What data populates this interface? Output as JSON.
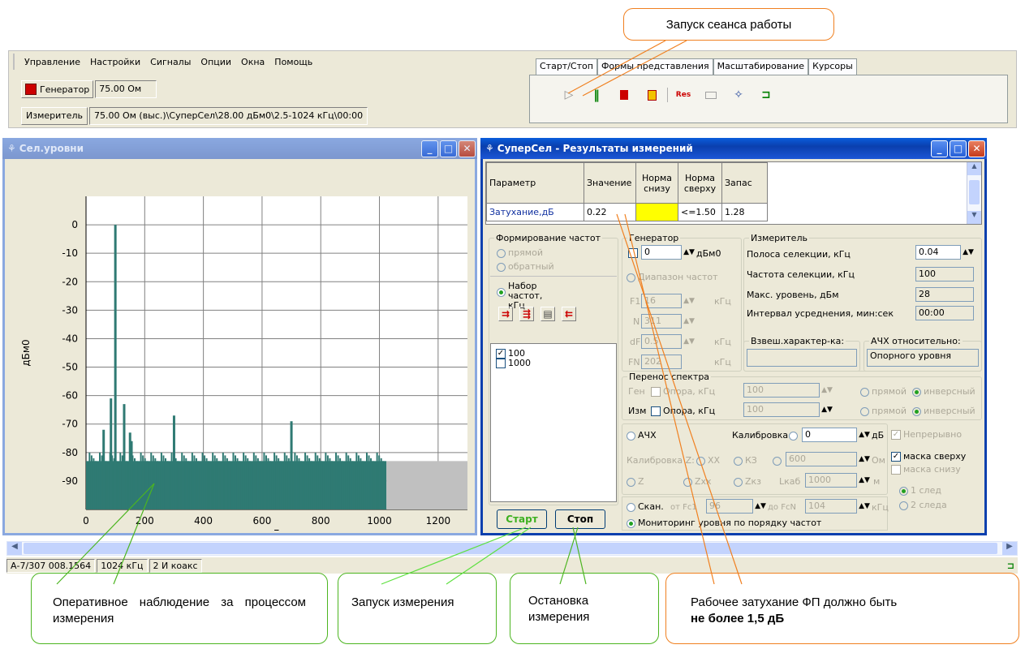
{
  "menu": [
    "Управление",
    "Настройки",
    "Сигналы",
    "Опции",
    "Окна",
    "Помощь"
  ],
  "generator": {
    "label": "Генератор",
    "value": "75.00 Ом"
  },
  "meter": {
    "label": "Измеритель",
    "value": "75.00 Ом (выс.)\\СуперСел\\28.00 дБм0\\2.5-1024 кГц\\00:00"
  },
  "tabs": [
    "Старт/Стоп",
    "Формы представления",
    "Масштабирование",
    "Курсоры"
  ],
  "toolbar": {
    "res_label": "Res",
    "colors": {
      "play": "#808080",
      "pause": "#008000",
      "stop": "#cc0000",
      "res": "#cc0000"
    }
  },
  "spectrum_window": {
    "title": "Сел.уровни",
    "ylabel": "дБм0",
    "xlabel": "кГц"
  },
  "chart_data": {
    "type": "area",
    "xlim": [
      0,
      1300
    ],
    "ylim": [
      -100,
      10
    ],
    "yticks": [
      0,
      -10,
      -20,
      -30,
      -40,
      -50,
      -60,
      -70,
      -80,
      -90
    ],
    "xticks": [
      0,
      200,
      400,
      600,
      800,
      1000,
      1200
    ],
    "ytick_labels": [
      "0",
      "-10",
      "-20",
      "-30",
      "-40",
      "-50",
      "-60",
      "-70",
      "-80",
      "-90"
    ],
    "xtick_labels": [
      "0",
      "200",
      "400",
      "600",
      "800",
      "1000",
      "1200"
    ],
    "xlabel": "кГц",
    "ylabel": "дБм0",
    "noise_floor": -83,
    "active_range_khz": [
      0,
      1024
    ],
    "peaks": [
      {
        "x": 100,
        "y": 0
      },
      {
        "x": 85,
        "y": -61
      },
      {
        "x": 130,
        "y": -63
      },
      {
        "x": 300,
        "y": -67
      },
      {
        "x": 700,
        "y": -69
      },
      {
        "x": 60,
        "y": -72
      },
      {
        "x": 150,
        "y": -73
      },
      {
        "x": 155,
        "y": -76
      }
    ],
    "colors": {
      "series": "#2f7a73",
      "inactive": "#c0c0c0"
    }
  },
  "results_window": {
    "title": "СуперСел - Результаты измерений"
  },
  "results_table": {
    "headers": [
      "Параметр",
      "Значение",
      "Норма снизу",
      "Норма сверху",
      "Запас"
    ],
    "row": {
      "param": "Затухание,дБ",
      "value": "0.22",
      "min": "",
      "max": "<=1.50",
      "margin": "1.28"
    }
  },
  "freq_form": {
    "title": "Формирование частот",
    "direct": "прямой",
    "reverse": "обратный",
    "set_label": "Набор частот, кГц",
    "items": [
      {
        "value": "100",
        "checked": true
      },
      {
        "value": "1000",
        "checked": false
      }
    ]
  },
  "gen_group": {
    "title": "Генератор",
    "level": "0",
    "unit": "дБм0",
    "range_label": "Диапазон частот",
    "f1_label": "F1",
    "f1": "16",
    "f1_unit": "кГц",
    "n_label": "N",
    "n": "311",
    "df_label": "dF",
    "df": "0.5",
    "df_unit": "кГц",
    "fn_label": "FN",
    "fn": "202",
    "fn_unit": "кГц"
  },
  "meter_group": {
    "title": "Измеритель",
    "bw_label": "Полоса селекции, кГц",
    "bw": "0.04",
    "freq_label": "Частота селекции, кГц",
    "freq": "100",
    "max_label": "Макс. уровень, дБм",
    "max": "28",
    "avg_label": "Интервал усреднения, мин:сек",
    "avg": "00:00",
    "weight_label": "Взвеш.характер-ка:",
    "weight": "",
    "afc_label": "АЧХ относительно:",
    "afc": "Опорного уровня"
  },
  "transfer": {
    "title": "Перенос спектра",
    "gen": "Ген",
    "gen_ref": "Опора, кГц",
    "gen_val": "100",
    "meas": "Изм",
    "meas_ref": "Опора, кГц",
    "meas_val": "100",
    "direct": "прямой",
    "inverse": "инверсный"
  },
  "calib": {
    "afc": "АЧХ",
    "calib_label": "Калибровка",
    "calib_val": "0",
    "calib_unit": "дБ",
    "continuous": "Непрерывно",
    "calibz": "Калибровка Z:",
    "xx": "XX",
    "kz": "КЗ",
    "z_val": "600",
    "z_unit": "Ом",
    "z": "Z",
    "zxx": "Zxx",
    "zks": "Zкз",
    "lcab": "Lкаб",
    "lcab_val": "1000",
    "lcab_unit": "м",
    "mask_top": "маска сверху",
    "mask_bottom": "маска снизу",
    "trace1": "1 след",
    "trace2": "2 следа",
    "scan": "Скан.",
    "scan_from": "от Fc1",
    "scan_from_val": "96",
    "scan_to": "до FcN",
    "scan_to_val": "104",
    "scan_unit": "кГц",
    "monitor": "Мониторинг уровня по порядку частот"
  },
  "buttons": {
    "start": "Старт",
    "stop": "Стоп"
  },
  "status": [
    "А-7/307 008.1564",
    "1024 кГц",
    "2 И коакс"
  ],
  "callouts": {
    "session": "Запуск сеанса работы",
    "observe": "Оперативное наблюдение за процессом измерения",
    "start": "Запуск измерения",
    "stop": "Остановка измерения",
    "attn_text": "Рабочее затухание ФП должно быть",
    "attn_bold": "не более 1,5 дБ"
  }
}
